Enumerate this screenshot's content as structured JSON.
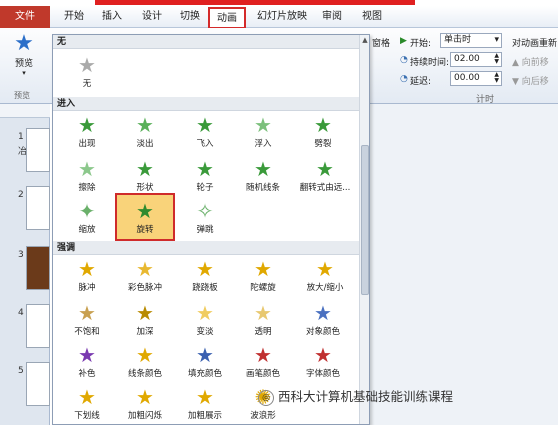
{
  "tabs": [
    "文件",
    "开始",
    "插入",
    "设计",
    "切换",
    "动画",
    "幻灯片放映",
    "审阅",
    "视图"
  ],
  "preview": {
    "label": "预览",
    "group": "预览"
  },
  "timing": {
    "start_label": "开始:",
    "start_value": "单击时",
    "duration_label": "持续时间:",
    "duration_value": "02.00",
    "delay_label": "延迟:",
    "delay_value": "00.00",
    "group_label": "计时",
    "reorder_label": "对动画重新",
    "move_earlier": "向前移",
    "move_later": "向后移",
    "ribbon_frag": "窗格"
  },
  "slides": [
    "1",
    "2",
    "3",
    "4",
    "5"
  ],
  "slide1_text": "冶",
  "sections": {
    "none": {
      "title": "无",
      "items": [
        "无"
      ]
    },
    "entrance": {
      "title": "进入",
      "items": [
        "出现",
        "淡出",
        "飞入",
        "浮入",
        "劈裂",
        "擦除",
        "形状",
        "轮子",
        "随机线条",
        "翻转式由远...",
        "缩放",
        "旋转",
        "弹跳"
      ]
    },
    "emphasis": {
      "title": "强调",
      "items": [
        "脉冲",
        "彩色脉冲",
        "跷跷板",
        "陀螺旋",
        "放大/缩小",
        "不饱和",
        "加深",
        "变淡",
        "透明",
        "对象颜色",
        "补色",
        "线条颜色",
        "填充颜色",
        "画笔颜色",
        "字体颜色",
        "下划线",
        "加粗闪烁",
        "加粗展示",
        "波浪形"
      ]
    }
  },
  "watermark": "西科大计算机基础技能训练课程"
}
